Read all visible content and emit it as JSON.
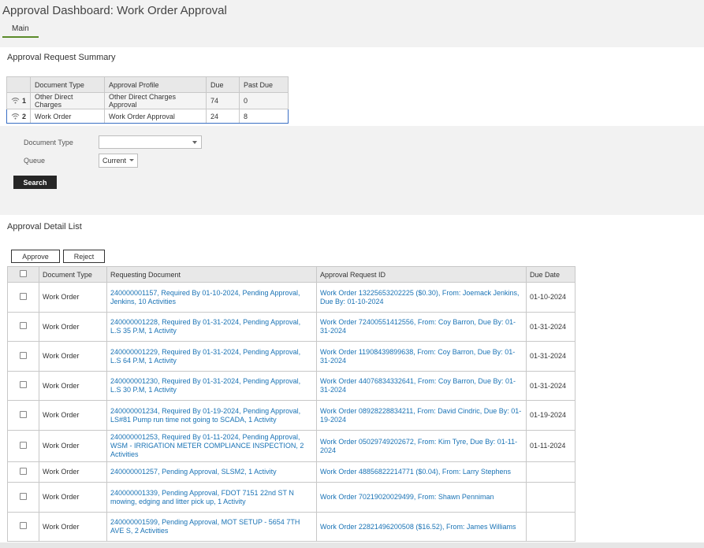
{
  "page": {
    "title": "Approval Dashboard: Work Order Approval"
  },
  "tabs": [
    {
      "label": "Main"
    }
  ],
  "summary": {
    "title": "Approval Request Summary",
    "columns": [
      "Document Type",
      "Approval Profile",
      "Due",
      "Past Due"
    ],
    "rows": [
      {
        "num": "1",
        "doc_type": "Other Direct Charges",
        "profile": "Other Direct Charges Approval",
        "due": "74",
        "past_due": "0"
      },
      {
        "num": "2",
        "doc_type": "Work Order",
        "profile": "Work Order Approval",
        "due": "24",
        "past_due": "8"
      }
    ]
  },
  "search_form": {
    "doc_type_label": "Document Type",
    "doc_type_value": "",
    "queue_label": "Queue",
    "queue_value": "Current",
    "search_label": "Search"
  },
  "detail": {
    "title": "Approval Detail List",
    "approve_label": "Approve",
    "reject_label": "Reject",
    "columns": [
      "Document Type",
      "Requesting Document",
      "Approval Request ID",
      "Due Date"
    ],
    "rows": [
      {
        "doc_type": "Work Order",
        "requesting": "240000001157, Required By 01-10-2024, Pending Approval, Jenkins, 10 Activities",
        "request_id": "Work Order 13225653202225 ($0.30), From: Joemack Jenkins, Due By: 01-10-2024",
        "due_date": "01-10-2024"
      },
      {
        "doc_type": "Work Order",
        "requesting": "240000001228, Required By 01-31-2024, Pending Approval, L.S 35 P.M, 1 Activity",
        "request_id": "Work Order 72400551412556, From: Coy Barron, Due By: 01-31-2024",
        "due_date": "01-31-2024"
      },
      {
        "doc_type": "Work Order",
        "requesting": "240000001229, Required By 01-31-2024, Pending Approval, L.S 64 P.M, 1 Activity",
        "request_id": "Work Order 11908439899638, From: Coy Barron, Due By: 01-31-2024",
        "due_date": "01-31-2024"
      },
      {
        "doc_type": "Work Order",
        "requesting": "240000001230, Required By 01-31-2024, Pending Approval, L.S 30 P.M, 1 Activity",
        "request_id": "Work Order 44076834332641, From: Coy Barron, Due By: 01-31-2024",
        "due_date": "01-31-2024"
      },
      {
        "doc_type": "Work Order",
        "requesting": "240000001234, Required By 01-19-2024, Pending Approval, LS#81 Pump run time not going to SCADA, 1 Activity",
        "request_id": "Work Order 08928228834211, From: David Cindric, Due By: 01-19-2024",
        "due_date": "01-19-2024"
      },
      {
        "doc_type": "Work Order",
        "requesting": "240000001253, Required By 01-11-2024, Pending Approval, WSM - IRRIGATION METER COMPLIANCE INSPECTION, 2 Activities",
        "request_id": "Work Order 05029749202672, From: Kim Tyre, Due By: 01-11-2024",
        "due_date": "01-11-2024"
      },
      {
        "doc_type": "Work Order",
        "requesting": "240000001257, Pending Approval, SLSM2, 1 Activity",
        "request_id": "Work Order 48856822214771 ($0.04), From: Larry Stephens",
        "due_date": ""
      },
      {
        "doc_type": "Work Order",
        "requesting": "240000001339, Pending Approval, FDOT 7151 22nd ST N mowing, edging and litter pick up, 1 Activity",
        "request_id": "Work Order 70219020029499, From: Shawn Penniman",
        "due_date": ""
      },
      {
        "doc_type": "Work Order",
        "requesting": "240000001599, Pending Approval, MOT SETUP - 5654 7TH AVE S, 2 Activities",
        "request_id": "Work Order 22821496200508 ($16.52), From: James Williams",
        "due_date": ""
      }
    ]
  },
  "colors": {
    "link": "#1a73b5",
    "tab_underline": "#5b8b2a",
    "selected_row_border": "#3a6fc4",
    "search_button": "#262626"
  }
}
